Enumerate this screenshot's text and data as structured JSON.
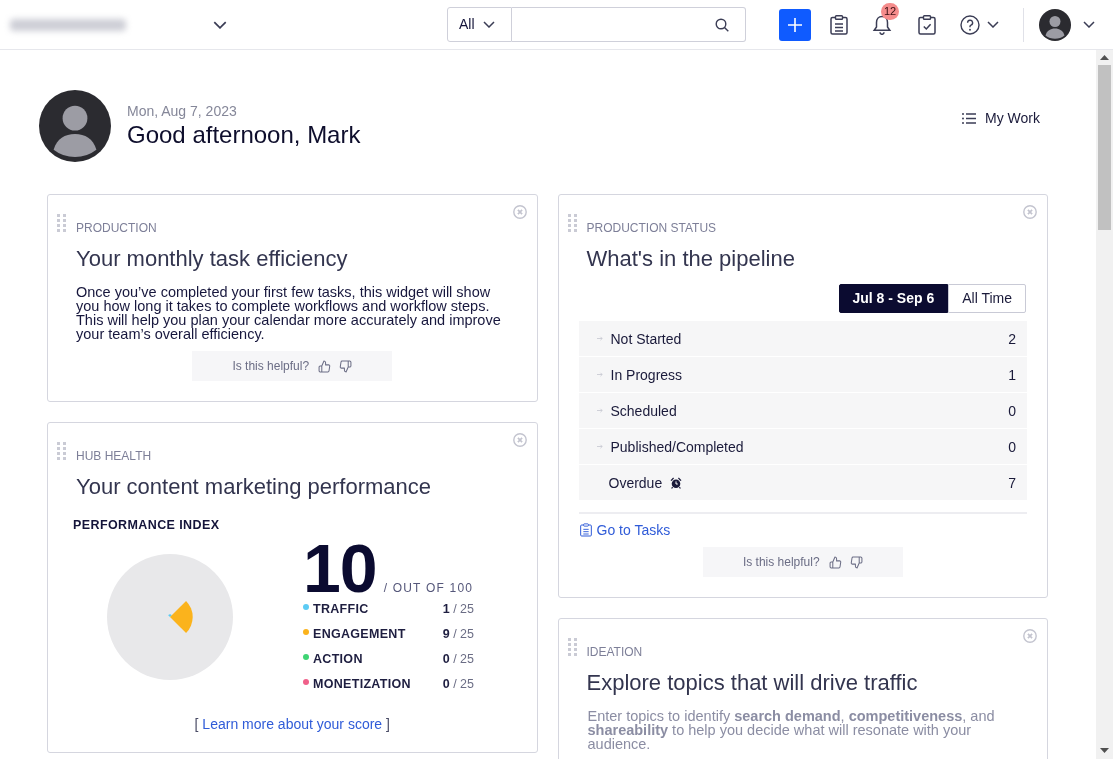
{
  "top_bar": {
    "scope": "All",
    "notification_count": "12"
  },
  "header": {
    "date": "Mon, Aug 7, 2023",
    "greeting": "Good afternoon, Mark",
    "my_work": "My Work"
  },
  "left_column": {
    "widgets": [
      {
        "kind": "efficiency",
        "label": "PRODUCTION",
        "title": "Your monthly task efficiency",
        "text": "Once you’ve completed your first few tasks, this widget will show you how long it takes to complete workflows and workflow steps. This will help you plan your calendar more accurately and improve your team’s overall efficiency.",
        "feedback": "Is this helpful?"
      },
      {
        "kind": "hub_health",
        "label": "HUB HEALTH",
        "title": "Your content marketing performance",
        "index_label": "PERFORMANCE INDEX",
        "score": "10",
        "score_suffix": "/ OUT OF 100",
        "legend": [
          {
            "label": "TRAFFIC",
            "score": "1",
            "max": "/ 25",
            "color": "#5ccbf4"
          },
          {
            "label": "ENGAGEMENT",
            "score": "9",
            "max": "/ 25",
            "color": "#fbb31c"
          },
          {
            "label": "ACTION",
            "score": "0",
            "max": "/ 25",
            "color": "#3fd474"
          },
          {
            "label": "MONETIZATION",
            "score": "0",
            "max": "/ 25",
            "color": "#f0608a"
          }
        ],
        "learn_more": {
          "before": "[",
          "link": "Learn more about your score",
          "after": "]"
        }
      }
    ]
  },
  "right_column": {
    "widgets": [
      {
        "kind": "pipeline",
        "label": "PRODUCTION STATUS",
        "title": "What's in the pipeline",
        "range_tabs": [
          {
            "label": "Jul 8 - Sep 6",
            "selected": true
          },
          {
            "label": "All Time",
            "selected": false
          }
        ],
        "statuses": [
          {
            "kind": "stage",
            "label": "Not Started",
            "count": "2"
          },
          {
            "kind": "stage",
            "label": "In Progress",
            "count": "1"
          },
          {
            "kind": "stage",
            "label": "Scheduled",
            "count": "0"
          },
          {
            "kind": "stage",
            "label": "Published/Completed",
            "count": "0"
          },
          {
            "kind": "overdue",
            "label": "Overdue",
            "count": "7"
          }
        ],
        "link": "Go to Tasks",
        "feedback": "Is this helpful?"
      },
      {
        "kind": "ideation",
        "label": "IDEATION",
        "title": "Explore topics that will drive traffic",
        "text": "Enter topics to identify **search demand**, **competitiveness**, and **shareability** to help you decide what will resonate with your audience."
      }
    ]
  }
}
